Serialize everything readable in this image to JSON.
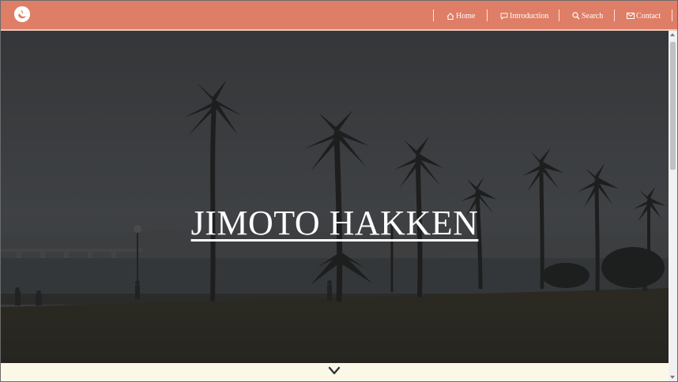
{
  "header": {
    "logo_icon": "crescent-logo-icon",
    "nav": [
      {
        "label": "Home",
        "icon": "home-icon"
      },
      {
        "label": "Introduction",
        "icon": "chat-bubble-icon"
      },
      {
        "label": "Search",
        "icon": "search-icon"
      },
      {
        "label": "Contact",
        "icon": "envelope-icon"
      }
    ],
    "background_color": "#df7e66"
  },
  "hero": {
    "title": "JIMOTO HAKKEN",
    "image": "seaside park with palm trees silhouettes at dusk",
    "overlay_color": "#2b2b2b"
  },
  "footer": {
    "scroll_down_icon": "chevron-down-icon",
    "background_color": "#fcf8e8"
  }
}
